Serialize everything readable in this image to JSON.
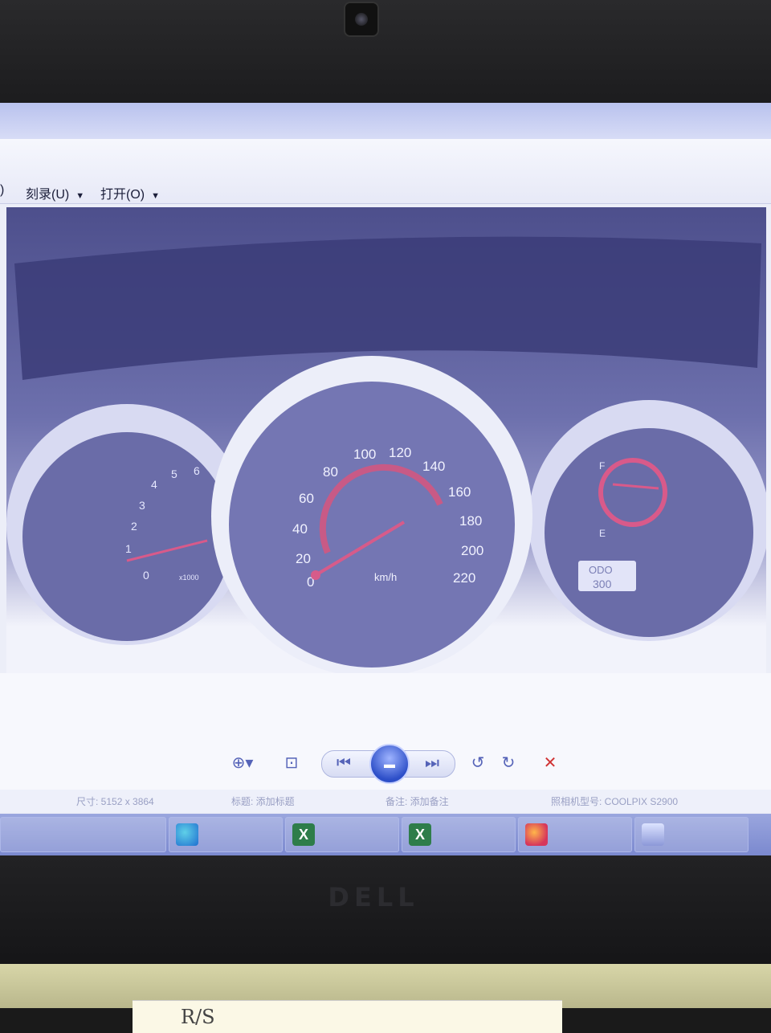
{
  "menu": {
    "items": [
      {
        "label": ")"
      },
      {
        "label": "刻录(U)"
      },
      {
        "label": "打开(O)"
      }
    ]
  },
  "photo": {
    "speedometer": {
      "ticks": [
        "0",
        "20",
        "40",
        "60",
        "80",
        "100",
        "120",
        "140",
        "160",
        "180",
        "200",
        "220"
      ],
      "unit": "km/h"
    },
    "tachometer": {
      "ticks": [
        "0",
        "1",
        "2",
        "3",
        "4",
        "5",
        "6"
      ],
      "unit": "x1000"
    },
    "fuel_gauge": {
      "marks": [
        "F",
        "E"
      ]
    },
    "odometer": {
      "line1": "ODO",
      "line2": "300"
    }
  },
  "controls": {
    "zoom": "zoom-icon",
    "fit": "actual-size-icon",
    "prev": "previous-icon",
    "play": "slideshow-icon",
    "next": "next-icon",
    "rotate_ccw": "rotate-ccw-icon",
    "rotate_cw": "rotate-cw-icon",
    "delete": "delete-icon",
    "accent": "#3a55c8",
    "delete_color": "#d03434"
  },
  "statusbar": {
    "dimensions": "尺寸: 5152 x 3864",
    "title": "标题: 添加标题",
    "comment": "备注: 添加备注",
    "camera": "照相机型号: COOLPIX S2900"
  },
  "taskbar": {
    "items": [
      "edge-icon",
      "excel-icon",
      "excel-icon",
      "firefox-icon",
      "photos-icon"
    ]
  },
  "laptop": {
    "logo": "DELL"
  },
  "paper": {
    "text": "R/S"
  }
}
